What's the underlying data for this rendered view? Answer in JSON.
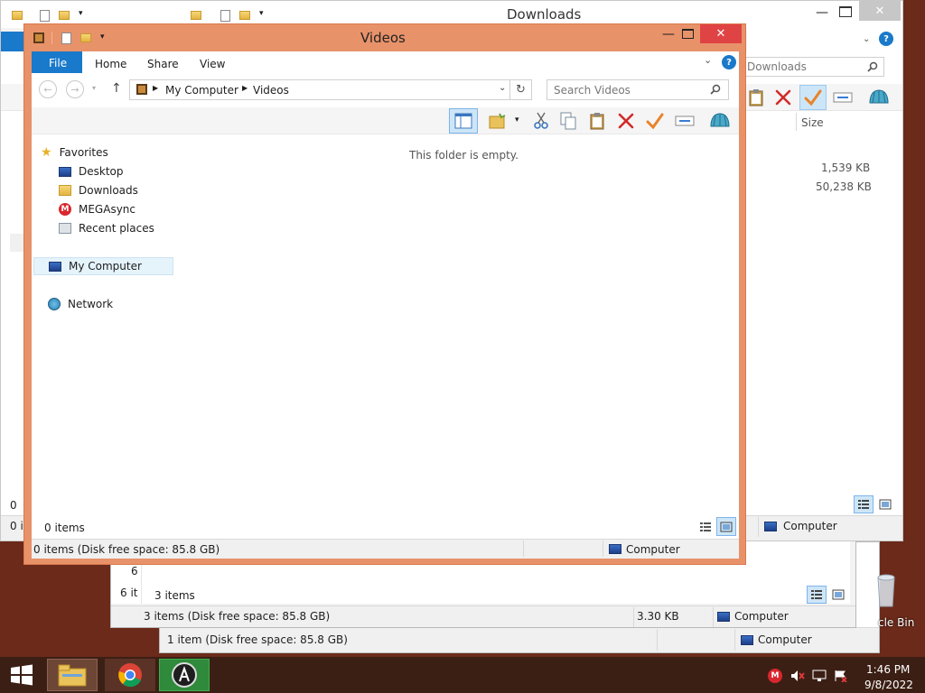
{
  "downloads_window": {
    "title": "Downloads",
    "search_placeholder": "Downloads",
    "column_size": "Size",
    "sizes": [
      "1,539 KB",
      "50,238 KB"
    ],
    "status_items": "0 it",
    "status_location": "Computer",
    "left_partial": "0"
  },
  "mid_window": {
    "partial_row": "6",
    "status_items_partial": "6 it",
    "items_count": "3 items",
    "status_text": "3 items (Disk free space: 85.8 GB)",
    "status_size": "3.30 KB",
    "status_location": "Computer"
  },
  "back_window": {
    "status_text": "1 item (Disk free space: 85.8 GB)",
    "status_location": "Computer"
  },
  "videos_window": {
    "title": "Videos",
    "ribbon_tabs": {
      "file": "File",
      "home": "Home",
      "share": "Share",
      "view": "View"
    },
    "breadcrumb": {
      "root": "My Computer",
      "current": "Videos"
    },
    "search_placeholder": "Search Videos",
    "empty_message": "This folder is empty.",
    "nav": {
      "favorites": "Favorites",
      "desktop": "Desktop",
      "downloads": "Downloads",
      "megasync": "MEGAsync",
      "recent": "Recent places",
      "computer": "My Computer",
      "network": "Network"
    },
    "items_count": "0 items",
    "status_text": "0 items (Disk free space: 85.8 GB)",
    "status_location": "Computer"
  },
  "desktop": {
    "recycle_bin_label": "cle Bin"
  },
  "taskbar": {
    "time": "1:46 PM",
    "date": "9/8/2022"
  },
  "colors": {
    "accent": "#1979ca",
    "active_frame": "#e8926a",
    "taskbar": "#3c1f14",
    "close_red": "#e04343"
  }
}
